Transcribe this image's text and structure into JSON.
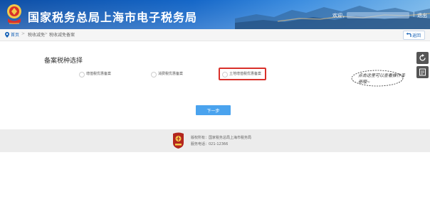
{
  "header": {
    "title": "国家税务总局上海市电子税务局",
    "welcome": "欢迎，",
    "separator": "|",
    "logout_label": "退出"
  },
  "breadcrumb": {
    "home": "首页",
    "sep": ">",
    "item1": "税收减免",
    "item2": "税收减免备案"
  },
  "back_label": "返回",
  "main": {
    "section_title": "备案税种选择",
    "options": [
      {
        "label": "增值税优惠备案",
        "selected": false
      },
      {
        "label": "消费税优惠备案",
        "selected": false
      },
      {
        "label": "土地增值税优惠备案",
        "selected": false,
        "highlighted": true
      }
    ],
    "next_label": "下一步"
  },
  "callout": {
    "text": "点击这里可以查看操作手册哦~"
  },
  "footer": {
    "copyright": "版权所有：国家税务总局上海市税务局",
    "service_phone": "服务电话：021-12366"
  },
  "colors": {
    "header_blue": "#1567c8",
    "button_blue": "#4aa3ee",
    "highlight_red": "#d9302a",
    "link_blue": "#1a64b8"
  }
}
